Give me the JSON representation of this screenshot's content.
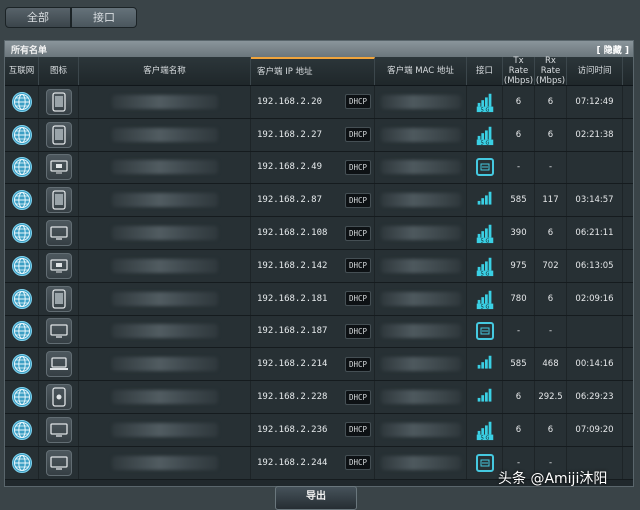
{
  "tabs": [
    "全部",
    "接口"
  ],
  "panel": {
    "title": "所有名单",
    "hide_label": "[ 隐藏 ]"
  },
  "columns": [
    "互联网",
    "图标",
    "客户端名称",
    "客户端 IP 地址",
    "客户端 MAC 地址",
    "接口",
    "Tx Rate (Mbps)",
    "Rx Rate (Mbps)",
    "访问时间"
  ],
  "dhcp_label": "DHCP",
  "rows": [
    {
      "ip": "192.168.2.20",
      "icon": "tablet-icon",
      "iface": "wifi-5g",
      "tx": "6",
      "rx": "6",
      "time": "07:12:49"
    },
    {
      "ip": "192.168.2.27",
      "icon": "tablet-icon",
      "iface": "wifi-5g",
      "tx": "6",
      "rx": "6",
      "time": "02:21:38"
    },
    {
      "ip": "192.168.2.49",
      "icon": "tv-icon",
      "iface": "ethernet",
      "tx": "-",
      "rx": "-",
      "time": ""
    },
    {
      "ip": "192.168.2.87",
      "icon": "tablet-icon",
      "iface": "wifi",
      "tx": "585",
      "rx": "117",
      "time": "03:14:57"
    },
    {
      "ip": "192.168.2.108",
      "icon": "monitor-icon",
      "iface": "wifi-5g",
      "tx": "390",
      "rx": "6",
      "time": "06:21:11"
    },
    {
      "ip": "192.168.2.142",
      "icon": "tv-icon",
      "iface": "wifi-5g",
      "tx": "975",
      "rx": "702",
      "time": "06:13:05"
    },
    {
      "ip": "192.168.2.181",
      "icon": "tablet-icon",
      "iface": "wifi-5g",
      "tx": "780",
      "rx": "6",
      "time": "02:09:16"
    },
    {
      "ip": "192.168.2.187",
      "icon": "monitor-icon",
      "iface": "ethernet",
      "tx": "-",
      "rx": "-",
      "time": ""
    },
    {
      "ip": "192.168.2.214",
      "icon": "laptop-icon",
      "iface": "wifi",
      "tx": "585",
      "rx": "468",
      "time": "00:14:16"
    },
    {
      "ip": "192.168.2.228",
      "icon": "mac-icon",
      "iface": "wifi",
      "tx": "6",
      "rx": "292.5",
      "time": "06:29:23"
    },
    {
      "ip": "192.168.2.236",
      "icon": "monitor-icon",
      "iface": "wifi-5g",
      "tx": "6",
      "rx": "6",
      "time": "07:09:20"
    },
    {
      "ip": "192.168.2.244",
      "icon": "monitor-icon",
      "iface": "ethernet",
      "tx": "-",
      "rx": "-",
      "time": ""
    }
  ],
  "export_label": "导出",
  "watermark": "头条 @Amiji沐阳"
}
